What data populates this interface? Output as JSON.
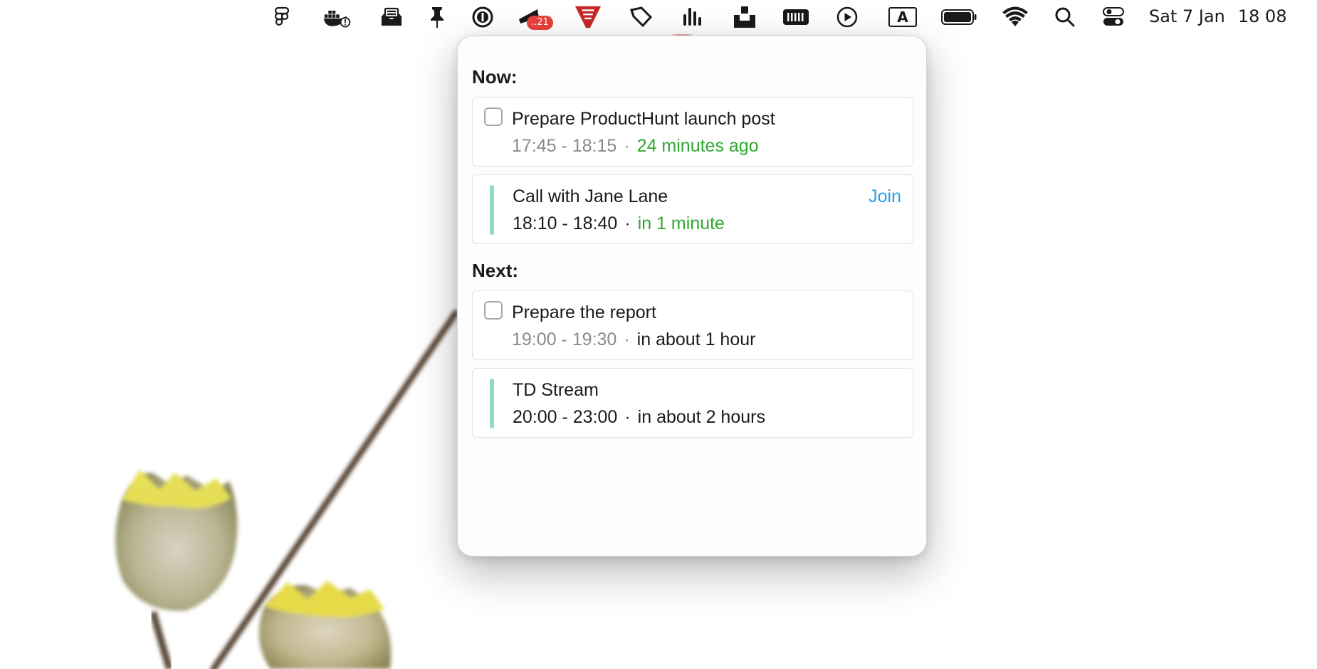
{
  "menubar": {
    "icons": [
      "figma-icon",
      "docker-icon",
      "inbox-tray-icon",
      "pin-icon",
      "onepassword-icon",
      "mail-icon",
      "shield-app-icon",
      "tag-icon",
      "audio-levels-icon",
      "unarchiver-icon",
      "keyboard-icon",
      "play-circle-icon",
      "input-source-icon",
      "battery-icon",
      "wifi-icon",
      "search-icon",
      "control-center-icon"
    ],
    "mail_badge": "..21",
    "input_source_letter": "A",
    "clock": {
      "date": "Sat 7 Jan",
      "time": "18 08"
    }
  },
  "popover": {
    "now_title": "Now:",
    "next_title": "Next:",
    "now": [
      {
        "kind": "task",
        "title": "Prepare ProductHunt launch post",
        "time": "17:45 - 18:15",
        "relative": "24 minutes ago"
      },
      {
        "kind": "event",
        "title": "Call with Jane Lane",
        "time": "18:10 - 18:40",
        "relative": "in 1 minute",
        "action": "Join"
      }
    ],
    "next": [
      {
        "kind": "task",
        "title": "Prepare the report",
        "time": "19:00 - 19:30",
        "relative": "in about 1 hour"
      },
      {
        "kind": "event",
        "title": "TD Stream",
        "time": "20:00 - 23:00",
        "relative": "in about 2 hours"
      }
    ],
    "separator": "·"
  },
  "colors": {
    "event_bar": "#8fdcb9",
    "relative_now": "#2fa82f",
    "join_link": "#2a9ee8",
    "badge": "#e8413c"
  }
}
